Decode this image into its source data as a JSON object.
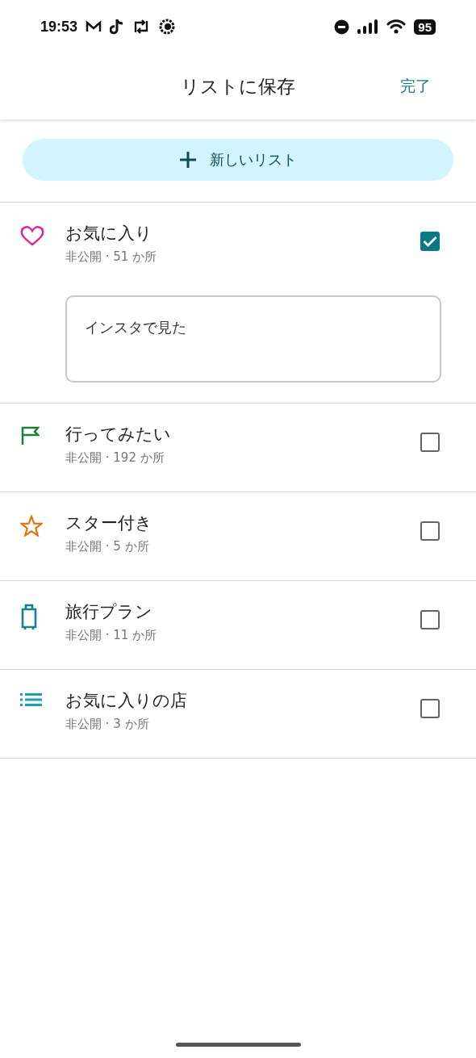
{
  "status_bar": {
    "time": "19:53",
    "battery": "95"
  },
  "header": {
    "title": "リストに保存",
    "done": "完了"
  },
  "new_list_button": {
    "label": "新しいリスト"
  },
  "lists": [
    {
      "kind": "heart",
      "name": "お気に入り",
      "meta": "非公開 · 51 か所",
      "checked": true,
      "note": "インスタで見た"
    },
    {
      "kind": "flag",
      "name": "行ってみたい",
      "meta": "非公開 · 192 か所",
      "checked": false
    },
    {
      "kind": "star",
      "name": "スター付き",
      "meta": "非公開 · 5 か所",
      "checked": false
    },
    {
      "kind": "suitcase",
      "name": "旅行プラン",
      "meta": "非公開 · 11 か所",
      "checked": false
    },
    {
      "kind": "list",
      "name": "お気に入りの店",
      "meta": "非公開 · 3 か所",
      "checked": false
    }
  ]
}
